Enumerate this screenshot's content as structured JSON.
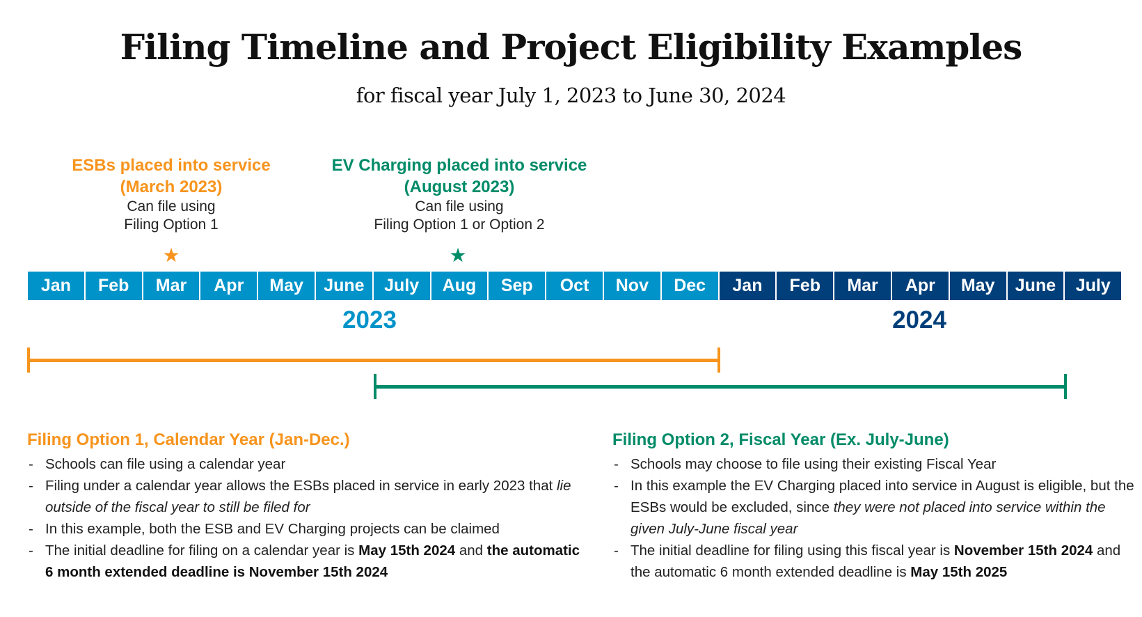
{
  "header": {
    "title": "Filing Timeline and Project Eligibility Examples",
    "subtitle": "for fiscal year July 1, 2023 to June 30, 2024"
  },
  "colors": {
    "option1_orange": "#f7941d",
    "option2_green": "#008b68",
    "year2023_blue": "#0093c9",
    "year2024_navy": "#003f7a"
  },
  "events": [
    {
      "id": "esb",
      "title": "ESBs placed into service",
      "date": "(March 2023)",
      "line1": "Can file using",
      "line2": "Filing Option 1",
      "month": "Mar 2023",
      "icon": "star-icon"
    },
    {
      "id": "ev",
      "title": "EV Charging placed into service",
      "date": "(August 2023)",
      "line1": "Can file using",
      "line2": "Filing Option 1 or Option 2",
      "month": "Aug 2023",
      "icon": "star-icon"
    }
  ],
  "timeline": {
    "months_2023": [
      "Jan",
      "Feb",
      "Mar",
      "Apr",
      "May",
      "June",
      "July",
      "Aug",
      "Sep",
      "Oct",
      "Nov",
      "Dec"
    ],
    "months_2024": [
      "Jan",
      "Feb",
      "Mar",
      "Apr",
      "May",
      "June",
      "July"
    ],
    "year_labels": [
      "2023",
      "2024"
    ],
    "ranges": [
      {
        "name": "Filing Option 1",
        "start": "Jan 2023",
        "end": "Jan 2024"
      },
      {
        "name": "Filing Option 2",
        "start": "July 2023",
        "end": "July 2024"
      }
    ]
  },
  "options": [
    {
      "heading": "Filing Option 1, Calendar Year (Jan-Dec.)",
      "bullets": [
        {
          "segments": [
            {
              "text": "Schools can file using a calendar year",
              "style": "normal"
            }
          ]
        },
        {
          "segments": [
            {
              "text": "Filing under a calendar year allows the ESBs placed in service in early 2023 that ",
              "style": "normal"
            },
            {
              "text": "lie outside of the fiscal year to still be filed for",
              "style": "italic"
            }
          ]
        },
        {
          "segments": [
            {
              "text": "In this example, both the ESB and EV Charging projects can be claimed",
              "style": "normal"
            }
          ]
        },
        {
          "segments": [
            {
              "text": "The initial deadline for filing on a calendar year is ",
              "style": "normal"
            },
            {
              "text": "May 15th 2024",
              "style": "bold"
            },
            {
              "text": " and ",
              "style": "normal"
            },
            {
              "text": "the automatic 6 month extended deadline is November 15th 2024",
              "style": "bold"
            }
          ]
        }
      ]
    },
    {
      "heading": "Filing Option 2, Fiscal Year (Ex. July-June)",
      "bullets": [
        {
          "segments": [
            {
              "text": "Schools may choose to file using their existing Fiscal Year",
              "style": "normal"
            }
          ]
        },
        {
          "segments": [
            {
              "text": "In this example the EV Charging placed into service in August is eligible, but the ESBs would be excluded, since ",
              "style": "normal"
            },
            {
              "text": "they were not placed into service within the given July-June fiscal year",
              "style": "italic"
            }
          ]
        },
        {
          "segments": [
            {
              "text": "The initial deadline for filing using this fiscal year is ",
              "style": "normal"
            },
            {
              "text": "November 15th 2024",
              "style": "bold"
            },
            {
              "text": " and the automatic 6 month extended deadline is ",
              "style": "normal"
            },
            {
              "text": "May 15th 2025",
              "style": "bold"
            }
          ]
        }
      ]
    }
  ],
  "bullet_marker": "-",
  "star_glyph": "★"
}
